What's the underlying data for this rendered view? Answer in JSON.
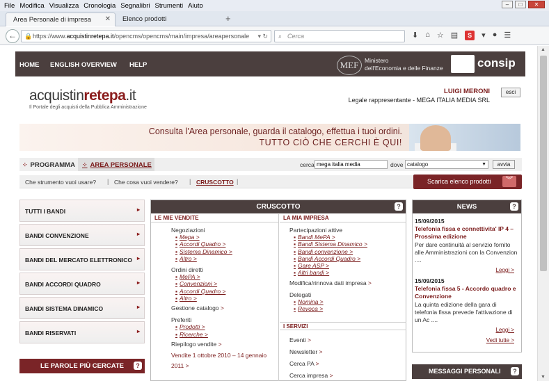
{
  "menubar": [
    "File",
    "Modifica",
    "Visualizza",
    "Cronologia",
    "Segnalibri",
    "Strumenti",
    "Aiuto"
  ],
  "tabs": [
    {
      "label": "Area Personale di impresa"
    },
    {
      "label": "Elenco prodotti"
    }
  ],
  "url": {
    "prefix": "https://www.",
    "host": "acquistinretepa.it",
    "path": "/opencms/opencms/main/impresa/areapersonale"
  },
  "search_placeholder": "Cerca",
  "topnav": {
    "home": "HOME",
    "english": "ENGLISH OVERVIEW",
    "help": "HELP",
    "mef_line1": "Ministero",
    "mef_line2": "dell'Economia e delle Finanze",
    "mef_logo": "MEF",
    "consip": "consip"
  },
  "logo": {
    "part1": "acquistin",
    "part2": "retepa",
    "part3": ".it",
    "tagline": "Il Portale degli acquisti della Pubblica Amministrazione"
  },
  "user": {
    "name": "LUIGI MERONI",
    "role": "Legale rappresentante - MEGA ITALIA MEDIA SRL",
    "logout": "esci"
  },
  "banner": {
    "line1": "Consulta l'Area personale, guarda il catalogo, effettua i tuoi ordini.",
    "line2": "TUTTO CIÒ CHE CERCHI È QUI!"
  },
  "nav": {
    "programma": "PROGRAMMA",
    "area": "AREA PERSONALE",
    "cerca_label": "cerca",
    "cerca_value": "mega italia media",
    "dove_label": "dove",
    "dove_value": "catalogo",
    "avvia": "avvia"
  },
  "questions": {
    "q1": "Che strumento vuoi usare?",
    "q2": "Che cosa vuoi vendere?",
    "q3": "CRUSCOTTO",
    "download": "Scarica elenco prodotti"
  },
  "sidebar": [
    "TUTTI I BANDI",
    "BANDI CONVENZIONE",
    "BANDI DEL MERCATO ELETTRONICO",
    "BANDI ACCORDI QUADRO",
    "BANDI SISTEMA DINAMICO",
    "BANDI RISERVATI"
  ],
  "parole": "LE PAROLE PIÙ CERCATE",
  "cruscotto": {
    "title": "CRUSCOTTO",
    "left_title": "LE MIE VENDITE",
    "right_title": "LA MIA IMPRESA",
    "negoziazioni": "Negoziazioni",
    "neg_links": [
      "Mepa >",
      "Accordi Quadro >",
      "Sistema Dinamico >",
      "Altro >"
    ],
    "ordini": "Ordini diretti",
    "ord_links": [
      "MePA >",
      "Convenzioni >",
      "Accordi Quadro >",
      "Altro >"
    ],
    "gestione": "Gestione catalogo",
    "preferiti": "Preferiti",
    "pref_links": [
      "Prodotti >",
      "Ricerche >"
    ],
    "riepilogo": "Riepilogo vendite",
    "vendite_periodo": "Vendite 1 ottobre 2010 – 14 gennaio",
    "vendite_anno": "2011 >",
    "partecipazioni": "Partecipazioni attive",
    "part_links": [
      "Bandi MePA >",
      "Bandi Sistema Dinamico >",
      "Bandi convenzione >",
      "Bandi Accordi Quadro >",
      "Gare ASP >",
      "Altri bandi >"
    ],
    "modifica": "Modifica/rinnova dati impresa",
    "delegati": "Delegati",
    "del_links": [
      "Nomina >",
      "Revoca >"
    ],
    "servizi_title": "I SERVIZI",
    "servizi": [
      "Eventi",
      "Newsletter",
      "Cerca PA",
      "Cerca impresa"
    ]
  },
  "news": {
    "title": "NEWS",
    "items": [
      {
        "date": "15/09/2015",
        "title": "Telefonia fissa e connettivita' IP 4 – Prossima edizione",
        "body": "Per dare continuità al servizio fornito alle Amministrazioni con la Convenzion ....",
        "more": "Leggi >"
      },
      {
        "date": "15/09/2015",
        "title": "Telefonia fissa 5 - Accordo quadro e Convenzione",
        "body": "La quinta edizione della gara di telefonia fissa prevede l'attivazione di un Ac ....",
        "more": "Leggi >"
      }
    ],
    "all": "Vedi tutte >"
  },
  "messaggi": "MESSAGGI PERSONALI"
}
